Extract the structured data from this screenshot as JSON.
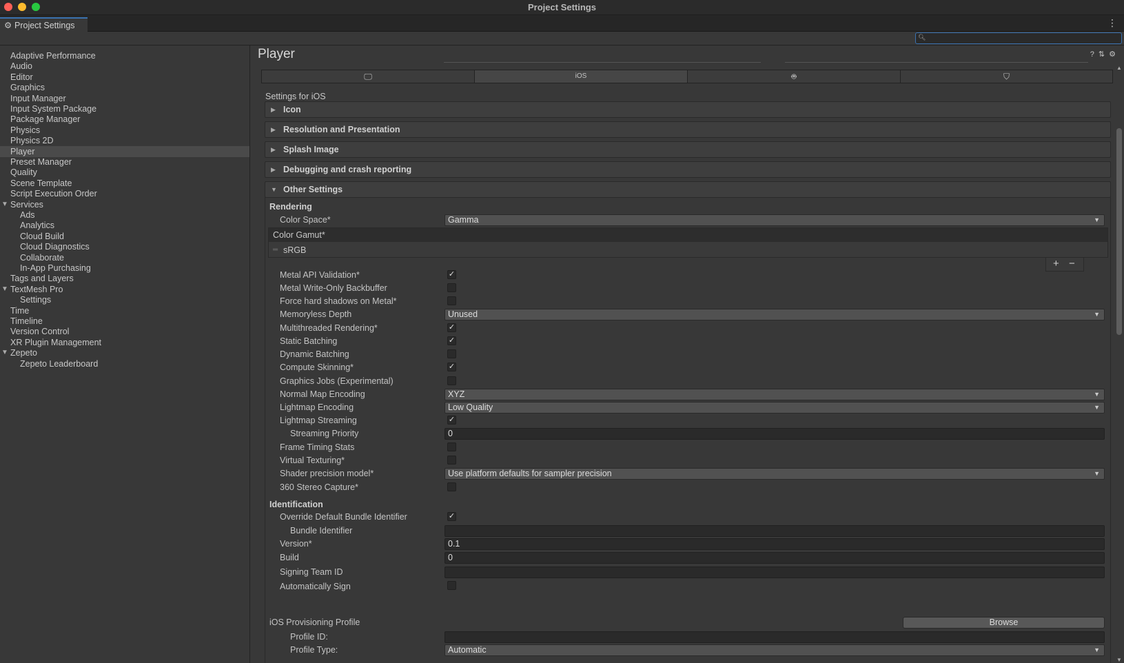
{
  "window": {
    "title": "Project Settings"
  },
  "tab": {
    "label": "Project Settings"
  },
  "search": {
    "value": ""
  },
  "sidebar": {
    "items": [
      {
        "label": "Adaptive Performance",
        "child": false,
        "active": false,
        "expandable": false
      },
      {
        "label": "Audio",
        "child": false,
        "active": false,
        "expandable": false
      },
      {
        "label": "Editor",
        "child": false,
        "active": false,
        "expandable": false
      },
      {
        "label": "Graphics",
        "child": false,
        "active": false,
        "expandable": false
      },
      {
        "label": "Input Manager",
        "child": false,
        "active": false,
        "expandable": false
      },
      {
        "label": "Input System Package",
        "child": false,
        "active": false,
        "expandable": false
      },
      {
        "label": "Package Manager",
        "child": false,
        "active": false,
        "expandable": false
      },
      {
        "label": "Physics",
        "child": false,
        "active": false,
        "expandable": false
      },
      {
        "label": "Physics 2D",
        "child": false,
        "active": false,
        "expandable": false
      },
      {
        "label": "Player",
        "child": false,
        "active": true,
        "expandable": false
      },
      {
        "label": "Preset Manager",
        "child": false,
        "active": false,
        "expandable": false
      },
      {
        "label": "Quality",
        "child": false,
        "active": false,
        "expandable": false
      },
      {
        "label": "Scene Template",
        "child": false,
        "active": false,
        "expandable": false
      },
      {
        "label": "Script Execution Order",
        "child": false,
        "active": false,
        "expandable": false
      },
      {
        "label": "Services",
        "child": false,
        "active": false,
        "expandable": true
      },
      {
        "label": "Ads",
        "child": true,
        "active": false,
        "expandable": false
      },
      {
        "label": "Analytics",
        "child": true,
        "active": false,
        "expandable": false
      },
      {
        "label": "Cloud Build",
        "child": true,
        "active": false,
        "expandable": false
      },
      {
        "label": "Cloud Diagnostics",
        "child": true,
        "active": false,
        "expandable": false
      },
      {
        "label": "Collaborate",
        "child": true,
        "active": false,
        "expandable": false
      },
      {
        "label": "In-App Purchasing",
        "child": true,
        "active": false,
        "expandable": false
      },
      {
        "label": "Tags and Layers",
        "child": false,
        "active": false,
        "expandable": false
      },
      {
        "label": "TextMesh Pro",
        "child": false,
        "active": false,
        "expandable": true
      },
      {
        "label": "Settings",
        "child": true,
        "active": false,
        "expandable": false
      },
      {
        "label": "Time",
        "child": false,
        "active": false,
        "expandable": false
      },
      {
        "label": "Timeline",
        "child": false,
        "active": false,
        "expandable": false
      },
      {
        "label": "Version Control",
        "child": false,
        "active": false,
        "expandable": false
      },
      {
        "label": "XR Plugin Management",
        "child": false,
        "active": false,
        "expandable": false
      },
      {
        "label": "Zepeto",
        "child": false,
        "active": false,
        "expandable": true
      },
      {
        "label": "Zepeto Leaderboard",
        "child": true,
        "active": false,
        "expandable": false
      }
    ]
  },
  "main": {
    "title": "Player",
    "platform_tabs": {
      "selected_label": "iOS"
    },
    "settings_for": "Settings for iOS",
    "foldouts": [
      "Icon",
      "Resolution and Presentation",
      "Splash Image",
      "Debugging and crash reporting",
      "Other Settings"
    ],
    "rendering": {
      "heading": "Rendering",
      "color_space_label": "Color Space*",
      "color_space_value": "Gamma",
      "color_gamut_label": "Color Gamut*",
      "color_gamut_item": "sRGB",
      "plus": "+",
      "minus": "−"
    },
    "rows": [
      {
        "label": "Metal API Validation*",
        "type": "check",
        "checked": true
      },
      {
        "label": "Metal Write-Only Backbuffer",
        "type": "check",
        "checked": false
      },
      {
        "label": "Force hard shadows on Metal*",
        "type": "check",
        "checked": false
      },
      {
        "label": "Memoryless Depth",
        "type": "dropdown",
        "value": "Unused"
      },
      {
        "label": "Multithreaded Rendering*",
        "type": "check",
        "checked": true
      },
      {
        "label": "Static Batching",
        "type": "check",
        "checked": true
      },
      {
        "label": "Dynamic Batching",
        "type": "check",
        "checked": false
      },
      {
        "label": "Compute Skinning*",
        "type": "check",
        "checked": true
      },
      {
        "label": "Graphics Jobs (Experimental)",
        "type": "check",
        "checked": false
      },
      {
        "label": "Normal Map Encoding",
        "type": "dropdown",
        "value": "XYZ"
      },
      {
        "label": "Lightmap Encoding",
        "type": "dropdown",
        "value": "Low Quality"
      },
      {
        "label": "Lightmap Streaming",
        "type": "check",
        "checked": true
      },
      {
        "label": "Streaming Priority",
        "type": "text",
        "value": "0",
        "indent": true
      },
      {
        "label": "Frame Timing Stats",
        "type": "check",
        "checked": false
      },
      {
        "label": "Virtual Texturing*",
        "type": "check",
        "checked": false
      },
      {
        "label": "Shader precision model*",
        "type": "dropdown",
        "value": "Use platform defaults for sampler precision"
      }
    ],
    "stereo": {
      "label": "360 Stereo Capture*",
      "checked": false
    },
    "identification": {
      "heading": "Identification",
      "override_label": "Override Default Bundle Identifier",
      "override_checked": true,
      "bundle_label": "Bundle Identifier",
      "bundle_value": "",
      "version_label": "Version*",
      "version_value": "0.1",
      "build_label": "Build",
      "build_value": "0",
      "team_label": "Signing Team ID",
      "team_value": "",
      "auto_sign_label": "Automatically Sign",
      "auto_sign_checked": false,
      "provisioning_label": "iOS Provisioning Profile",
      "browse_label": "Browse",
      "profile_id_label": "Profile ID:",
      "profile_id_value": "",
      "profile_type_label": "Profile Type:",
      "profile_type_value": "Automatic"
    }
  }
}
